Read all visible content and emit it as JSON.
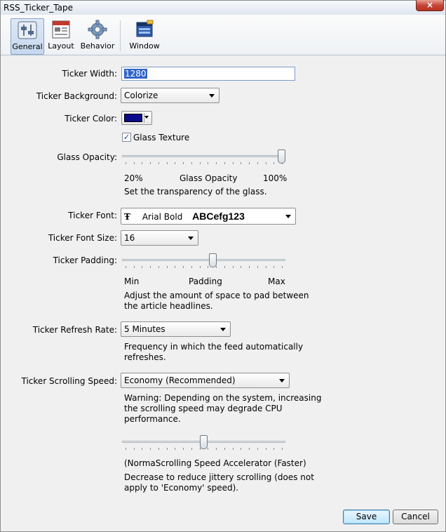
{
  "window": {
    "title": "RSS_Ticker_Tape",
    "close_glyph": "×"
  },
  "toolbar": {
    "tabs": [
      {
        "label": "General",
        "icon": "settings-sliders-icon",
        "active": true
      },
      {
        "label": "Layout",
        "icon": "layout-icon",
        "active": false
      },
      {
        "label": "Behavior",
        "icon": "gear-icon",
        "active": false
      },
      {
        "label": "Window",
        "icon": "window-icon",
        "active": false
      }
    ]
  },
  "form": {
    "ticker_width": {
      "label": "Ticker Width:",
      "value": "1280"
    },
    "ticker_background": {
      "label": "Ticker Background:",
      "value": "Colorize"
    },
    "ticker_color": {
      "label": "Ticker Color:",
      "swatch": "#0a0a8c"
    },
    "glass_texture": {
      "label": "Glass Texture",
      "checked": true
    },
    "glass_opacity": {
      "label": "Glass Opacity:",
      "level": 1.0,
      "min_label": "20%",
      "mid_label": "Glass Opacity",
      "max_label": "100%",
      "help": "Set the transparency of the glass."
    },
    "ticker_font": {
      "label": "Ticker Font:",
      "font_name": "Arial Bold",
      "sample": "ABCefg123"
    },
    "ticker_font_size": {
      "label": "Ticker Font Size:",
      "value": "16"
    },
    "ticker_padding": {
      "label": "Ticker Padding:",
      "level": 0.56,
      "min_label": "Min",
      "mid_label": "Padding",
      "max_label": "Max",
      "help_line1": "Adjust the amount of space to pad between",
      "help_line2": "the article headlines."
    },
    "refresh_rate": {
      "label": "Ticker Refresh Rate:",
      "value": "5 Minutes",
      "help_line1": "Frequency in which the feed automatically",
      "help_line2": "refreshes."
    },
    "scrolling_speed": {
      "label": "Ticker Scrolling Speed:",
      "value": "Economy (Recommended)",
      "warn_line1": "Warning: Depending on the system, increasing",
      "warn_line2": "the scrolling speed may degrade CPU",
      "warn_line3": "performance."
    },
    "accelerator": {
      "level": 0.5,
      "caption": "(NormaScrolling Speed Accelerator (Faster)",
      "help_line1": "Decrease to reduce jittery scrolling (does not",
      "help_line2": "apply to 'Economy' speed)."
    }
  },
  "buttons": {
    "save": "Save",
    "cancel": "Cancel"
  }
}
